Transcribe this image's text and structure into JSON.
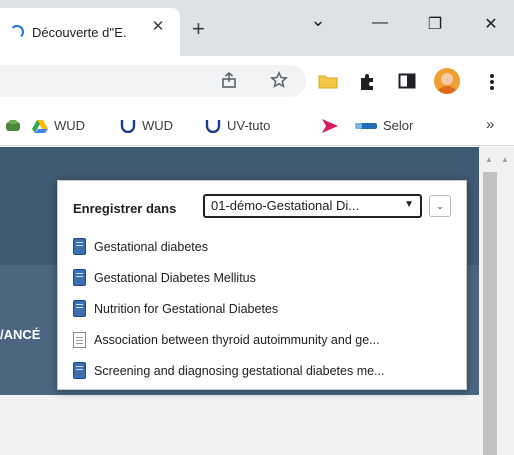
{
  "browser": {
    "tab_title": "Découverte d''E.",
    "tab_close": "✕",
    "new_tab": "+",
    "tab_search": "⌄",
    "minimize": "—",
    "restore": "❐",
    "close": "✕"
  },
  "toolbar": {
    "icons": [
      "share-icon",
      "star-icon",
      "zotero-folder-icon",
      "extensions-icon",
      "side-panel-icon",
      "avatar",
      "menu-icon"
    ]
  },
  "bookmarks": {
    "items": [
      {
        "label": "WUD",
        "icon": "drive-icon"
      },
      {
        "label": "WUD",
        "icon": "u-logo-icon"
      },
      {
        "label": "UV-tuto",
        "icon": "u-logo-icon"
      },
      {
        "label": "",
        "icon": "arrow-logo-icon"
      },
      {
        "label": "Selor",
        "icon": "selor-icon"
      }
    ],
    "overflow": "»"
  },
  "page": {
    "partial_text": "/ANCÉ"
  },
  "save_popup": {
    "label": "Enregistrer dans",
    "selected_folder": "01-démo-Gestational Di...",
    "items": [
      {
        "text": "Gestational diabetes",
        "icon": "book-icon"
      },
      {
        "text": "Gestational Diabetes Mellitus",
        "icon": "book-icon"
      },
      {
        "text": "Nutrition for Gestational Diabetes",
        "icon": "book-icon"
      },
      {
        "text": "Association between thyroid autoimmunity and ge...",
        "icon": "document-icon"
      },
      {
        "text": "Screening and diagnosing gestational diabetes me...",
        "icon": "book-icon"
      }
    ]
  },
  "colors": {
    "header_dark": "#3f5a73",
    "header_mid": "#4a6680",
    "book_blue": "#3c6fb0",
    "tab_strip": "#dee1e6"
  }
}
